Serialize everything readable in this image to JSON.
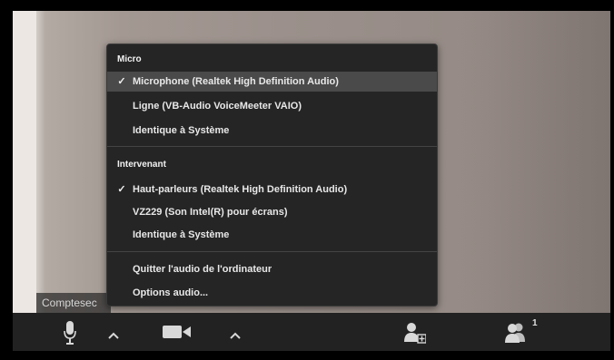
{
  "video": {
    "participant_name": "Comptesec"
  },
  "audio_menu": {
    "mic_header": "Micro",
    "mic_items": [
      {
        "label": "Microphone (Realtek High Definition Audio)",
        "checked": true
      },
      {
        "label": "Ligne (VB-Audio VoiceMeeter VAIO)",
        "checked": false
      },
      {
        "label": "Identique à Système",
        "checked": false
      }
    ],
    "speaker_header": "Intervenant",
    "speaker_items": [
      {
        "label": "Haut-parleurs (Realtek High Definition Audio)",
        "checked": true
      },
      {
        "label": "VZ229 (Son Intel(R) pour écrans)",
        "checked": false
      },
      {
        "label": "Identique à Système",
        "checked": false
      }
    ],
    "actions": [
      {
        "label": "Quitter l'audio de l'ordinateur"
      },
      {
        "label": "Options audio..."
      }
    ],
    "check_glyph": "✓"
  },
  "toolbar": {
    "mic_icon": "microphone-icon",
    "mic_caret_icon": "caret-up-icon",
    "video_icon": "video-camera-icon",
    "video_caret_icon": "caret-up-icon",
    "invite_icon": "add-participant-icon",
    "participants_icon": "participants-icon",
    "participants_count": "1"
  },
  "colors": {
    "menu_bg": "#252525",
    "menu_selected": "#4a4a4a",
    "toolbar_bg": "#222222",
    "frame": "#000000"
  }
}
